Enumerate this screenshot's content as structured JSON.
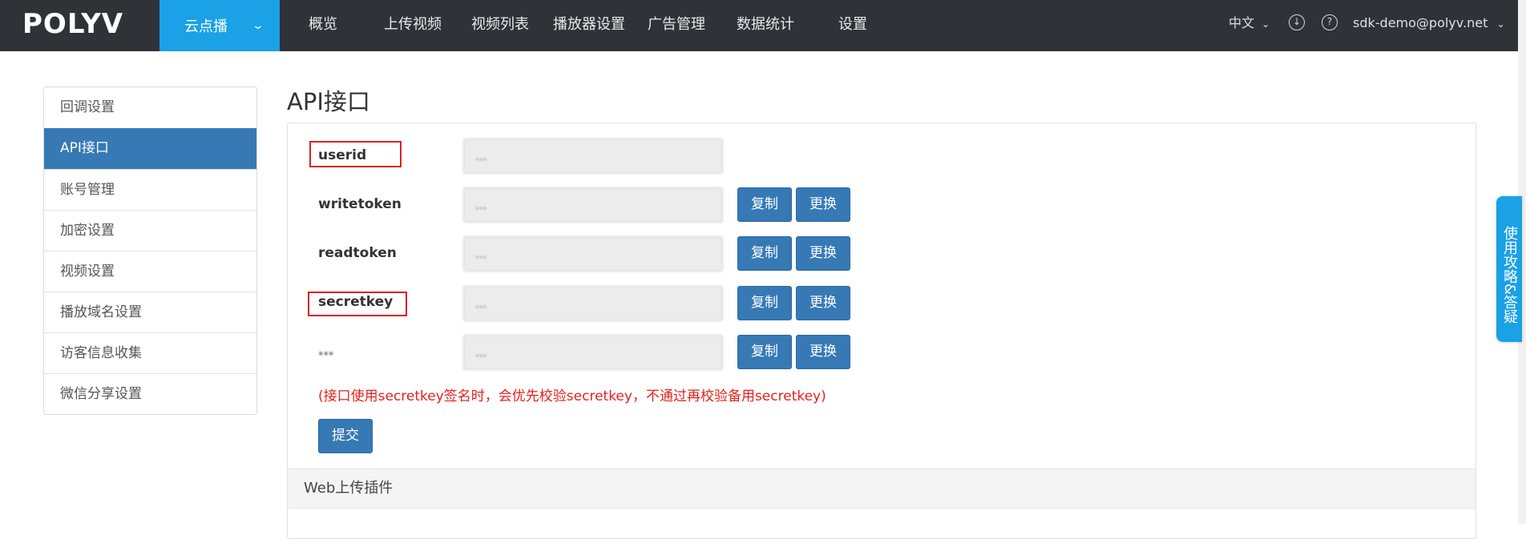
{
  "topbar": {
    "logo": "POLYV",
    "product": "云点播",
    "nav": [
      "概览",
      "上传视频",
      "视频列表",
      "播放器设置",
      "广告管理",
      "数据统计",
      "设置"
    ],
    "language": "中文",
    "download_icon": "download-icon",
    "help_icon": "help-icon",
    "user": "sdk-demo@polyv.net"
  },
  "sidebar": {
    "items": [
      {
        "label": "回调设置",
        "active": false
      },
      {
        "label": "API接口",
        "active": true
      },
      {
        "label": "账号管理",
        "active": false
      },
      {
        "label": "加密设置",
        "active": false
      },
      {
        "label": "视频设置",
        "active": false
      },
      {
        "label": "播放域名设置",
        "active": false
      },
      {
        "label": "访客信息收集",
        "active": false
      },
      {
        "label": "微信分享设置",
        "active": false
      }
    ]
  },
  "main": {
    "title": "API接口",
    "fields": [
      {
        "label": "userid",
        "value": "...",
        "buttons": false
      },
      {
        "label": "writetoken",
        "value": "...",
        "buttons": true
      },
      {
        "label": "readtoken",
        "value": "...",
        "buttons": true
      },
      {
        "label": "secretkey",
        "value": "...",
        "buttons": true
      },
      {
        "label": "...",
        "value": "...",
        "buttons": true
      }
    ],
    "copy_label": "复制",
    "replace_label": "更换",
    "note": "(接口使用secretkey签名时，会优先校验secretkey，不通过再校验备用secretkey)",
    "submit_label": "提交",
    "web_upload_title": "Web上传插件"
  },
  "help_tab": "使用攻略&答疑",
  "colors": {
    "topbar": "#2f3338",
    "product_accent": "#1aa1e6",
    "primary_button": "#3679b5",
    "note_text": "#e8201a",
    "highlight_box": "#e02020"
  }
}
